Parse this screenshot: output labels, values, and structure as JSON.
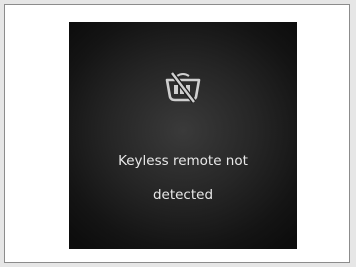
{
  "screen": {
    "icon": "keyless-remote-not-detected-icon",
    "message_line1": "Keyless remote not",
    "message_line2": "detected",
    "text_color": "#e8e8e8",
    "background_color": "#1a1a1a"
  }
}
